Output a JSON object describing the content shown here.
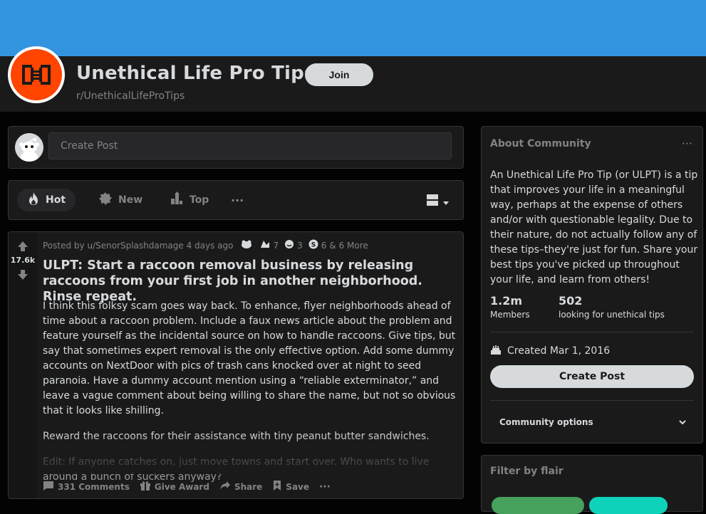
{
  "subreddit": {
    "title": "Unethical Life Pro Tips",
    "name": "r/UnethicalLifeProTips",
    "join_label": "Join",
    "banner_color": "#3394e0",
    "icon_color": "#ff4500"
  },
  "create_post": {
    "placeholder": "Create Post"
  },
  "sort": {
    "hot": "Hot",
    "new": "New",
    "top": "Top",
    "more": "···"
  },
  "post": {
    "votes": "17.6k",
    "posted_by": "Posted by u/SenorSplashdamage 4 days ago",
    "awards": [
      {
        "icon": "award-icon-1",
        "count": ""
      },
      {
        "icon": "award-icon-2",
        "count": "7"
      },
      {
        "icon": "award-icon-3",
        "count": "3"
      },
      {
        "icon": "award-icon-4",
        "count": "6"
      }
    ],
    "more_awards": "& 6 More",
    "title": "ULPT: Start a raccoon removal business by releasing raccoons from your first job in another neighborhood. Rinse repeat.",
    "body": [
      "I think this folksy scam goes way back. To enhance, flyer neighborhoods ahead of time about a raccoon problem. Include a faux news article about the problem and feature yourself as the incidental source on how to handle raccoons. Give tips, but say that sometimes expert removal is the only effective option. Add some dummy accounts on NextDoor with pics of trash cans knocked over at night to seed paranoia. Have a dummy account mention using a “reliable exterminator,” and leave a vague comment about being willing to share the name, but not so obvious that it looks like shilling.",
      "Reward the raccoons for their assistance with tiny peanut butter sandwiches.",
      "Edit: If anyone catches on, just move towns and start over. Who wants to live around a bunch of suckers anyway?"
    ],
    "comments": "331 Comments",
    "give_award": "Give Award",
    "share": "Share",
    "save": "Save",
    "more": "···"
  },
  "about": {
    "heading": "About Community",
    "more": "···",
    "description": "An Unethical Life Pro Tip (or ULPT) is a tip that improves your life in a meaningful way, perhaps at the expense of others and/or with questionable legality. Due to their nature, do not actually follow any of these tips–they're just for fun. Share your best tips you've picked up throughout your life, and learn from others!",
    "members_count": "1.2m",
    "members_label": "Members",
    "online_count": "502",
    "online_label": "looking for unethical tips",
    "created": "Created Mar 1, 2016",
    "create_post_label": "Create Post",
    "community_options": "Community options"
  },
  "flair": {
    "heading": "Filter by flair",
    "pill_colors": [
      "#46a15c",
      "#0dd3bb"
    ]
  }
}
